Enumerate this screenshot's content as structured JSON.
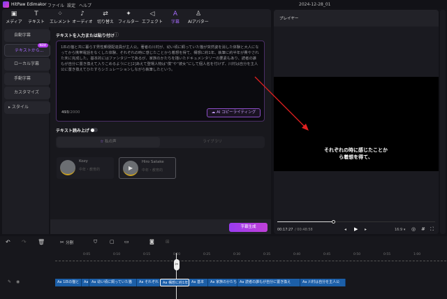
{
  "app": {
    "name": "HitPaw Edimakor",
    "menu": [
      "ファイル",
      "設定",
      "ヘルプ"
    ],
    "project": "2024-12-28_01"
  },
  "toolbar": [
    {
      "label": "メディア",
      "icon": "media-icon"
    },
    {
      "label": "テキスト",
      "icon": "text-icon"
    },
    {
      "label": "エレメント",
      "icon": "element-icon"
    },
    {
      "label": "オーディオ",
      "icon": "audio-icon"
    },
    {
      "label": "切り替え",
      "icon": "transition-icon"
    },
    {
      "label": "フィルター",
      "icon": "filter-icon"
    },
    {
      "label": "エフェクト",
      "icon": "effect-icon"
    },
    {
      "label": "字幕",
      "icon": "subtitle-icon",
      "active": true
    },
    {
      "label": "AIアバター",
      "icon": "avatar-icon"
    }
  ],
  "sidebar": {
    "items": [
      {
        "label": "自動字幕"
      },
      {
        "label": "テキストから...",
        "badge": "NEW",
        "active": true
      },
      {
        "label": "ローカル字幕"
      },
      {
        "label": "手動字幕"
      },
      {
        "label": "カスタマイズ"
      },
      {
        "label": "スタイル"
      }
    ]
  },
  "editor": {
    "heading": "テキストを入力または貼り付け",
    "text": "1匹の猫と共に暮らす男性郵便配達員が主人公。著者の川村が、幼い頃に飼っていた猫が突然姿を消した体験と大人になってから携帯電話をなくした体験、それぞれの時に感じたことから着想を得て、構想に約1年、執筆に約半年が費やされた末に完成した。基本的にはファンタジーであるが、家族のかたちを描いたドキュメンタリーの要素もあり、読者の誰もが自分に置き換えて入りこめるようにと[2]あえて登場人物は“僕”や“彼女”にして個人名を付けず、川村は自分を主人公に置き換えてひたすらシミュレーションしながら執筆したという。",
    "count": "493",
    "max": "/2000",
    "ai_button": "AI コピーライティング"
  },
  "tts": {
    "label": "テキスト読み上げ",
    "enabled": false,
    "tabs": [
      "私の声",
      "ライブラリ"
    ],
    "voices": [
      {
        "name": "Kozy",
        "desc": "中年・教育的"
      },
      {
        "name": "Hiro Satake",
        "desc": "中年・教育的",
        "selected": true
      }
    ],
    "generate": "字幕生成"
  },
  "player": {
    "title": "プレイヤー",
    "subtitle": "それぞれの時に感じたことから着想を得て、",
    "current": "00:17:27",
    "total": "/ 00:48:58",
    "progress": 0.36,
    "ratio": "16:9 ▾"
  },
  "timeline": {
    "split_label": "分割",
    "ticks": [
      "0:05",
      "0:10",
      "0:15",
      "0:20",
      "0:25",
      "0:30",
      "0:35",
      "0:40",
      "0:45",
      "0:50",
      "0:55",
      "1:00"
    ],
    "clips": [
      "Aa 1匹の猫と",
      "Aa",
      "Aa 幼い頃に飼っていた猫",
      "Aa それぞれ",
      "Aa 構想に約1年",
      "Aa 基本",
      "Aa 家族のかたち",
      "Aa 読者の誰もが自分に置き換え",
      "Aa 川村は自分を主人公"
    ]
  },
  "colors": {
    "accent": "#a86bff",
    "clip": "#1c5fa8",
    "button": "#b53cf0"
  }
}
